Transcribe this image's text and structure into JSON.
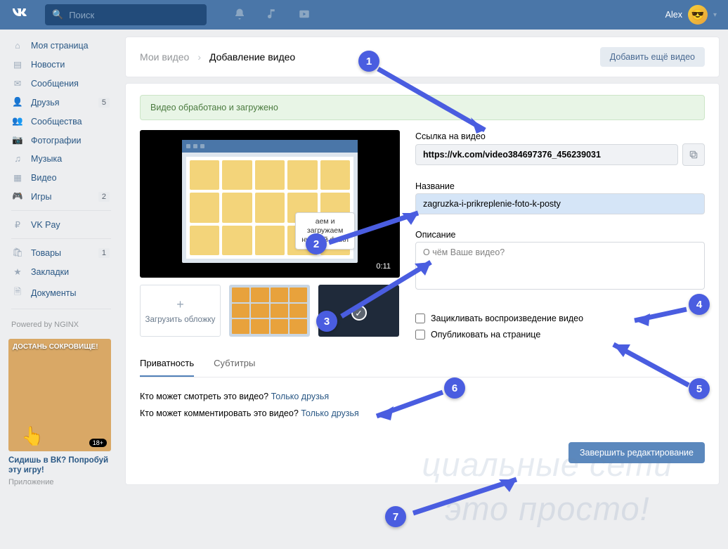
{
  "top": {
    "search_ph": "Поиск",
    "user": "Alex"
  },
  "side": {
    "items": [
      {
        "icon": "⌂",
        "label": "Моя страница"
      },
      {
        "icon": "▤",
        "label": "Новости"
      },
      {
        "icon": "✉",
        "label": "Сообщения"
      },
      {
        "icon": "👤",
        "label": "Друзья",
        "badge": "5"
      },
      {
        "icon": "👥",
        "label": "Сообщества"
      },
      {
        "icon": "📷",
        "label": "Фотографии"
      },
      {
        "icon": "♫",
        "label": "Музыка"
      },
      {
        "icon": "▦",
        "label": "Видео"
      },
      {
        "icon": "🎮",
        "label": "Игры",
        "badge": "2"
      }
    ],
    "items2": [
      {
        "icon": "₽",
        "label": "VK Pay"
      }
    ],
    "items3": [
      {
        "icon": "🛍",
        "label": "Товары",
        "badge": "1"
      },
      {
        "icon": "★",
        "label": "Закладки"
      },
      {
        "icon": "🗎",
        "label": "Документы"
      }
    ],
    "powered": "Powered by NGINX",
    "promo": {
      "title": "ДОСТАНЬ СОКРОВИЩЕ!",
      "age": "18+",
      "cap1": "Сидишь в ВК? Попробуй эту игру!",
      "cap2": "Приложение"
    }
  },
  "hdr": {
    "crumb1": "Мои видео",
    "crumb2": "Добавление видео",
    "addbtn": "Добавить ещё видео"
  },
  "ok": "Видео обработано и загружено",
  "video": {
    "duration": "0:11",
    "tip_l1": "аем и",
    "tip_l2": "загружаем",
    "tip_l3": "нужный файл",
    "upload_thumb": "Загрузить обложку"
  },
  "form": {
    "link_label": "Ссылка на видео",
    "link_value": "https://vk.com/video384697376_456239031",
    "title_label": "Название",
    "title_value": "zagruzka-i-prikreplenie-foto-k-posty",
    "desc_label": "Описание",
    "desc_ph": "О чём Ваше видео?",
    "chk1": "Зацикливать воспроизведение видео",
    "chk2": "Опубликовать на странице"
  },
  "tabs": {
    "t1": "Приватность",
    "t2": "Субтитры"
  },
  "priv": {
    "q1": "Кто может смотреть это видео?",
    "a1": "Только друзья",
    "q2": "Кто может комментировать это видео?",
    "a2": "Только друзья"
  },
  "finish": "Завершить редактирование",
  "wm": {
    "l1": "циальные сети",
    "l2": "это просто!"
  }
}
